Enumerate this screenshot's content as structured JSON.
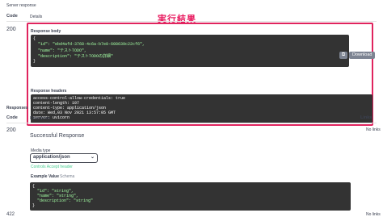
{
  "server_response": {
    "section_title": "Server response",
    "col_code": "Code",
    "col_details": "Details",
    "status_code": "200",
    "annotation": "実行結果",
    "response_body_label": "Response body",
    "body_lines": [
      "{",
      "  \"id\": \"ebd4afd-3768-4c6a-b7e0-608639c22cf6\",",
      "  \"name\": \"テストTODO\",",
      "  \"description\": \"テストTODOの詳細\"",
      "}"
    ],
    "copy_icon": "copy-icon",
    "download_label": "Download",
    "response_headers_label": "Response headers",
    "header_lines": [
      "access-control-allow-credentials: true",
      "content-length: 107",
      "content-type: application/json",
      "date: Wed,03 Nov 2021 13:57:05 GMT",
      "server: uvicorn"
    ]
  },
  "responses": {
    "section_title": "Responses",
    "col_code": "Code",
    "col_description": "Description",
    "col_links": "Links",
    "row_200": {
      "code": "200",
      "description": "Successful Response",
      "links": "No links",
      "media_type_label": "Media type",
      "media_type_value": "application/json",
      "controls_accept": "Controls Accept header",
      "example_value_tab": "Example Value",
      "schema_tab": "Schema",
      "example_lines": [
        "{",
        "  \"id\": \"string\",",
        "  \"name\": \"string\",",
        "  \"description\": \"string\"",
        "}"
      ]
    },
    "row_422": {
      "code": "422",
      "links": "No links"
    }
  },
  "colors": {
    "annotation": "#e8195e",
    "code_bg": "#333333",
    "string_green": "#a2fca2",
    "accept_green": "#49cc90"
  }
}
